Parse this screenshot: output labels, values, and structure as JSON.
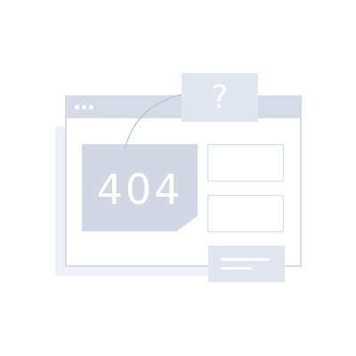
{
  "illustration": {
    "error_code": "404",
    "question_mark": "?",
    "icons": {
      "window_dots": "window-controls-icon",
      "connector": "curved-arrow-icon",
      "message": "message-lines-icon"
    },
    "colors": {
      "window_frame": "#d7dbe8",
      "error_block": "#d2d7e3",
      "cards": "#e2e6f0",
      "shadow": "#eef1f7",
      "connector_line": "#b8bfcf"
    }
  }
}
